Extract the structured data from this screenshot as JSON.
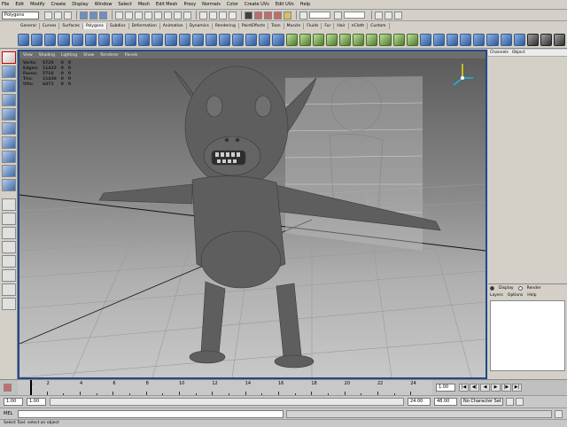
{
  "menubar": {
    "items": [
      "File",
      "Edit",
      "Modify",
      "Create",
      "Display",
      "Window",
      "Select",
      "Mesh",
      "Edit Mesh",
      "Proxy",
      "Normals",
      "Color",
      "Create UVs",
      "Edit UVs",
      "Help"
    ]
  },
  "statusline": {
    "mode": "Polygons"
  },
  "shelf": {
    "tabs": [
      "General",
      "Curves",
      "Surfaces",
      "Polygons",
      "Subdivs",
      "Deformation",
      "Animation",
      "Dynamics",
      "Rendering",
      "PaintEffects",
      "Toon",
      "Muscle",
      "Fluids",
      "Fur",
      "Hair",
      "nCloth",
      "Custom"
    ],
    "active_tab": "Polygons"
  },
  "viewport": {
    "menu": [
      "View",
      "Shading",
      "Lighting",
      "Show",
      "Renderer",
      "Panels"
    ],
    "hud": [
      {
        "label": "Verts:",
        "a": "5720",
        "b": "0",
        "c": "0"
      },
      {
        "label": "Edges:",
        "a": "11432",
        "b": "0",
        "c": "0"
      },
      {
        "label": "Faces:",
        "a": "5716",
        "b": "0",
        "c": "0"
      },
      {
        "label": "Tris:",
        "a": "11436",
        "b": "0",
        "c": "0"
      },
      {
        "label": "UVs:",
        "a": "6471",
        "b": "0",
        "c": "0"
      }
    ]
  },
  "channelbox": {
    "header": [
      "Channels",
      "Object"
    ],
    "layer_radios": [
      "Display",
      "Render"
    ],
    "layer_menu": [
      "Layers",
      "Options",
      "Help"
    ]
  },
  "timeslider": {
    "ticks": [
      "1",
      "2",
      "4",
      "6",
      "8",
      "10",
      "12",
      "14",
      "16",
      "18",
      "20",
      "22",
      "24"
    ],
    "current_frame": "1.00",
    "playback": [
      "|◀",
      "◀|",
      "◀",
      "▶",
      "|▶",
      "▶|"
    ]
  },
  "rangeslider": {
    "start": "1.00",
    "start2": "1.00",
    "end": "24.00",
    "end2": "48.00",
    "character_set": "No Character Set"
  },
  "cmdline": {
    "label": "MEL"
  },
  "helpline": {
    "text": "Select Tool: select an object"
  }
}
